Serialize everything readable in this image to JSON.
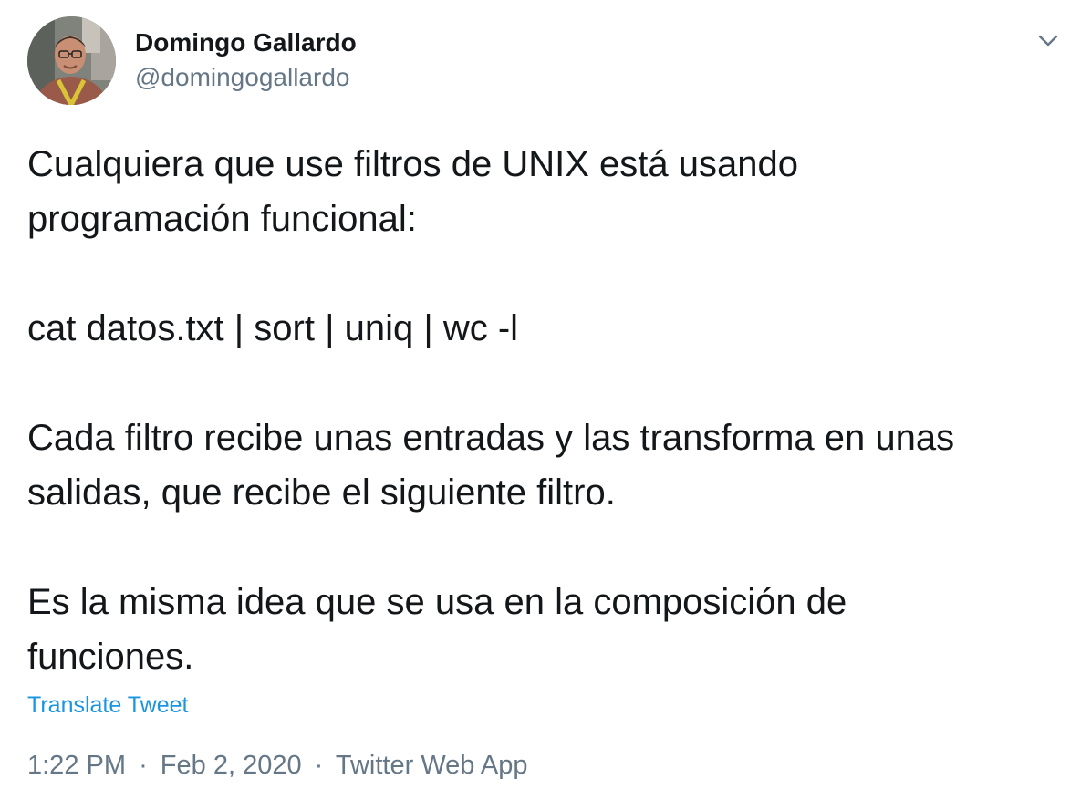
{
  "author": {
    "display_name": "Domingo Gallardo",
    "handle": "@domingogallardo"
  },
  "tweet": {
    "line1": "Cualquiera que use filtros de UNIX está usando",
    "line2": "programación funcional:",
    "line3": "cat datos.txt | sort | uniq | wc -l",
    "line4": "Cada filtro recibe unas entradas y las transforma en unas",
    "line5": "salidas, que recibe el siguiente filtro.",
    "line6": "Es la misma idea que se usa en la composición de",
    "line7": "funciones."
  },
  "translate_label": "Translate Tweet",
  "meta": {
    "time": "1:22 PM",
    "separator": "·",
    "date": "Feb 2, 2020",
    "source": "Twitter Web App"
  },
  "icons": {
    "menu": "chevron-down-icon"
  },
  "colors": {
    "text": "#14171a",
    "secondary": "#657786",
    "link": "#1b95e0"
  }
}
